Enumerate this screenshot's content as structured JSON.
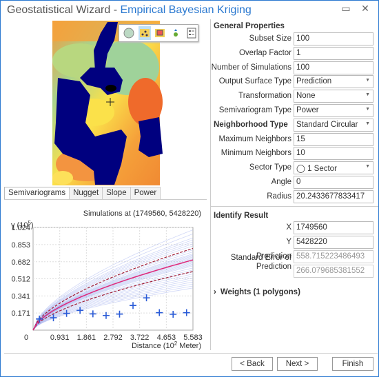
{
  "window": {
    "title": "Geostatistical Wizard",
    "subtitle": "Empirical Bayesian Kriging",
    "maximize_icon": "maximize-icon",
    "close_icon": "close-icon"
  },
  "map": {
    "tools": [
      "full-extent-icon",
      "show-points-icon",
      "show-surface-icon",
      "add-point-icon",
      "legend-icon"
    ],
    "colors": {
      "points": "#00007f",
      "high": "#f05a23",
      "mid": "#fdd835",
      "low": "#8ecf9a"
    }
  },
  "tabs": [
    "Semivariograms",
    "Nugget",
    "Slope",
    "Power"
  ],
  "chart_data": {
    "type": "line",
    "title": "Simulations at (1749560, 5428220)",
    "ylabel_prefix": "γ (10",
    "ylabel_exp": "5",
    "ylabel_suffix": ")",
    "xlabel_prefix": "Distance (10",
    "xlabel_exp": "2",
    "xlabel_suffix": " Meter)",
    "xlim": [
      0,
      5.583
    ],
    "ylim": [
      0,
      1.024
    ],
    "xticks": [
      "0",
      "0.931",
      "1.861",
      "2.792",
      "3.722",
      "4.653",
      "5.583"
    ],
    "yticks": [
      "0.171",
      "0.341",
      "0.512",
      "0.682",
      "0.853",
      "1.024"
    ],
    "grid": true,
    "empirical_points": {
      "x": [
        0.22,
        0.71,
        1.17,
        1.64,
        2.09,
        2.55,
        3.02,
        3.49,
        3.96,
        4.41,
        4.89,
        5.36
      ],
      "y": [
        0.111,
        0.123,
        0.167,
        0.197,
        0.162,
        0.146,
        0.16,
        0.246,
        0.322,
        0.174,
        0.158,
        0.174
      ]
    },
    "median_curve_end": 0.7,
    "upper_quantile_end": 0.815,
    "lower_quantile_end": 0.584,
    "simulation_curve_ends": [
      1.0,
      0.96,
      0.92,
      0.9,
      0.88,
      0.86,
      0.84,
      0.8,
      0.78,
      0.76,
      0.75,
      0.74,
      0.73,
      0.72,
      0.71,
      0.7,
      0.69,
      0.68,
      0.67,
      0.66,
      0.65,
      0.64,
      0.62,
      0.6,
      0.58,
      0.56,
      0.54,
      0.52,
      0.5,
      0.48,
      0.46,
      0.44,
      0.42
    ],
    "colors": {
      "simulations": "#7b8ee8",
      "median": "#e0287a",
      "quantiles": "#a0203a",
      "points": "#2a5bd7"
    }
  },
  "properties": {
    "general_header": "General Properties",
    "rows": [
      {
        "label": "Subset Size",
        "value": "100"
      },
      {
        "label": "Overlap Factor",
        "value": "1"
      },
      {
        "label": "Number of Simulations",
        "value": "100"
      },
      {
        "label": "Output Surface Type",
        "value": "Prediction",
        "dropdown": true
      },
      {
        "label": "Transformation",
        "value": "None",
        "dropdown": true
      },
      {
        "label": "Semivariogram Type",
        "value": "Power",
        "dropdown": true
      },
      {
        "label": "Neighborhood Type",
        "value": "Standard Circular",
        "dropdown": true
      },
      {
        "label": "Maximum Neighbors",
        "value": "15"
      },
      {
        "label": "Minimum Neighbors",
        "value": "10"
      },
      {
        "label": "Sector Type",
        "value": "1 Sector",
        "dropdown": true
      },
      {
        "label": "Angle",
        "value": "0"
      },
      {
        "label": "Radius",
        "value": "20.2433677833417"
      }
    ],
    "identify_header": "Identify Result",
    "identify": [
      {
        "label": "X",
        "value": "1749560"
      },
      {
        "label": "Y",
        "value": "5428220"
      },
      {
        "label": "Prediction",
        "value": "558.715223486493"
      },
      {
        "label": "Standard Error of Prediction",
        "value": "266.079685381552"
      }
    ],
    "weights": "Weights (1 polygons)"
  },
  "buttons": {
    "back": "< Back",
    "next": "Next >",
    "finish": "Finish"
  }
}
